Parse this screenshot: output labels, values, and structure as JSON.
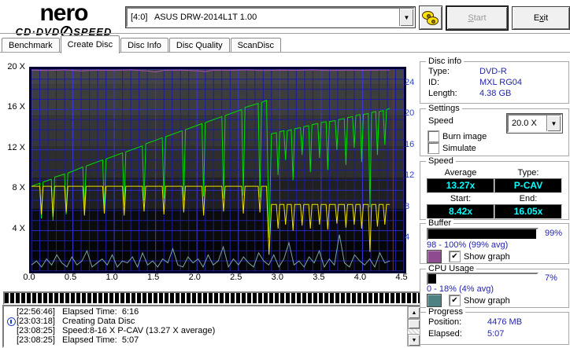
{
  "header": {
    "logo_name": "nero",
    "logo_sub_left": "CD·DVD",
    "logo_sub_right": "SPEED",
    "drive_selector": "[4:0]   ASUS DRW-2014L1T 1.00",
    "start_button": {
      "u": "S",
      "rest": "tart"
    },
    "exit_button": {
      "pre": "E",
      "u": "x",
      "rest": "it"
    }
  },
  "tabs": [
    {
      "label": "Benchmark",
      "active": false
    },
    {
      "label": "Create Disc",
      "active": true
    },
    {
      "label": "Disc Info",
      "active": false
    },
    {
      "label": "Disc Quality",
      "active": false
    },
    {
      "label": "ScanDisc",
      "active": false
    }
  ],
  "disc_info": {
    "title": "Disc info",
    "type_label": "Type:",
    "type_value": "DVD-R",
    "id_label": "ID:",
    "id_value": "MXL RG04",
    "length_label": "Length:",
    "length_value": "4.38 GB"
  },
  "settings": {
    "title": "Settings",
    "speed_label": "Speed",
    "speed_value": "20.0 X",
    "burn_image_label": "Burn image",
    "simulate_label": "Simulate",
    "burn_image_checked": false,
    "simulate_checked": false
  },
  "speed_panel": {
    "title": "Speed",
    "average_label": "Average",
    "average_value": "13.27x",
    "type_label": "Type:",
    "type_value": "P-CAV",
    "start_label": "Start:",
    "start_value": "8.42x",
    "end_label": "End:",
    "end_value": "16.05x"
  },
  "buffer_panel": {
    "title": "Buffer",
    "percent_label": "99%",
    "percent_value": 99,
    "range_text": "98 - 100% (99% avg)",
    "show_graph_label": "Show graph",
    "show_graph_checked": true,
    "swatch_color": "#8e4b8e"
  },
  "cpu_panel": {
    "title": "CPU Usage",
    "percent_label": "7%",
    "percent_value": 7,
    "range_text": "0 - 18% (4% avg)",
    "show_graph_label": "Show graph",
    "show_graph_checked": true,
    "swatch_color": "#4e8282"
  },
  "progress_panel": {
    "title": "Progress",
    "position_label": "Position:",
    "position_value": "4476 MB",
    "elapsed_label": "Elapsed:",
    "elapsed_value": "5:07"
  },
  "write_progress_percent": 100,
  "log": {
    "entries": [
      {
        "time": "[22:56:46]",
        "text": "Elapsed Time:  6:16",
        "icon": false
      },
      {
        "time": "[23:03:18]",
        "text": "Creating Data Disc",
        "icon": true
      },
      {
        "time": "[23:08:25]",
        "text": "Speed:8-16 X P-CAV (13.27 X average)",
        "icon": false
      },
      {
        "time": "[23:08:25]",
        "text": "Elapsed Time:  5:07",
        "icon": false
      }
    ]
  },
  "chart_data": {
    "type": "line",
    "x_max": 4.5,
    "x_ticks": [
      "0.0",
      "0.5",
      "1.0",
      "1.5",
      "2.0",
      "2.5",
      "3.0",
      "3.5",
      "4.0",
      "4.5"
    ],
    "left_axis": {
      "max": 20,
      "ticks": [
        20,
        16,
        12,
        8,
        4
      ],
      "suffix": " X"
    },
    "right_axis": {
      "max": 26,
      "ticks": [
        24,
        20,
        16,
        12,
        8,
        4
      ]
    },
    "position_line_x": 4.37,
    "position_line_color": "#cc1111",
    "series": [
      {
        "name": "write-speed",
        "color": "#00dd00",
        "axis": "left",
        "points": [
          [
            0,
            8.4
          ],
          [
            0.1,
            8.7
          ],
          [
            0.12,
            5.2
          ],
          [
            0.14,
            8.8
          ],
          [
            0.24,
            9.1
          ],
          [
            0.26,
            5.0
          ],
          [
            0.28,
            9.3
          ],
          [
            0.4,
            9.6
          ],
          [
            0.42,
            5.6
          ],
          [
            0.44,
            9.7
          ],
          [
            0.62,
            10.3
          ],
          [
            0.64,
            6.2
          ],
          [
            0.66,
            10.4
          ],
          [
            0.86,
            11.0
          ],
          [
            0.88,
            6.0
          ],
          [
            0.9,
            11.1
          ],
          [
            1.1,
            11.7
          ],
          [
            1.12,
            6.5
          ],
          [
            1.14,
            11.8
          ],
          [
            1.34,
            12.4
          ],
          [
            1.36,
            7.0
          ],
          [
            1.38,
            12.6
          ],
          [
            1.58,
            13.2
          ],
          [
            1.6,
            7.2
          ],
          [
            1.62,
            13.3
          ],
          [
            1.82,
            13.9
          ],
          [
            1.84,
            7.0
          ],
          [
            1.86,
            14.0
          ],
          [
            2.06,
            14.6
          ],
          [
            2.08,
            7.4
          ],
          [
            2.1,
            14.7
          ],
          [
            2.3,
            15.3
          ],
          [
            2.32,
            7.2
          ],
          [
            2.34,
            15.4
          ],
          [
            2.54,
            16.0
          ],
          [
            2.56,
            7.5
          ],
          [
            2.58,
            16.2
          ],
          [
            2.74,
            16.6
          ],
          [
            2.76,
            7.3
          ],
          [
            2.78,
            16.7
          ],
          [
            2.84,
            16.9
          ],
          [
            2.87,
            3.3
          ],
          [
            2.9,
            13.6
          ],
          [
            2.96,
            13.7
          ],
          [
            2.98,
            9.5
          ],
          [
            3.0,
            13.8
          ],
          [
            3.05,
            13.9
          ],
          [
            3.07,
            11.0
          ],
          [
            3.09,
            13.9
          ],
          [
            3.14,
            14.0
          ],
          [
            3.16,
            9.0
          ],
          [
            3.18,
            14.1
          ],
          [
            3.25,
            14.2
          ],
          [
            3.27,
            11.5
          ],
          [
            3.29,
            14.3
          ],
          [
            3.35,
            14.4
          ],
          [
            3.37,
            9.8
          ],
          [
            3.39,
            14.5
          ],
          [
            3.46,
            14.6
          ],
          [
            3.48,
            11.2
          ],
          [
            3.5,
            14.7
          ],
          [
            3.56,
            14.8
          ],
          [
            3.58,
            10.0
          ],
          [
            3.6,
            14.8
          ],
          [
            3.67,
            14.9
          ],
          [
            3.69,
            12.0
          ],
          [
            3.71,
            15.0
          ],
          [
            3.78,
            15.1
          ],
          [
            3.8,
            10.5
          ],
          [
            3.82,
            15.2
          ],
          [
            3.88,
            15.3
          ],
          [
            3.9,
            12.2
          ],
          [
            3.92,
            15.4
          ],
          [
            3.97,
            15.5
          ],
          [
            3.99,
            10.8
          ],
          [
            4.01,
            15.5
          ],
          [
            4.07,
            15.6
          ],
          [
            4.09,
            6.3
          ],
          [
            4.11,
            15.7
          ],
          [
            4.16,
            15.8
          ],
          [
            4.18,
            11.5
          ],
          [
            4.2,
            15.8
          ],
          [
            4.25,
            15.9
          ],
          [
            4.27,
            12.5
          ],
          [
            4.29,
            16.0
          ],
          [
            4.33,
            16.1
          ]
        ]
      },
      {
        "name": "read-speed",
        "color": "#ece000",
        "axis": "left",
        "points": [
          [
            0,
            8.4
          ],
          [
            0.1,
            8.4
          ],
          [
            0.12,
            5.6
          ],
          [
            0.14,
            8.4
          ],
          [
            0.24,
            8.4
          ],
          [
            0.26,
            5.4
          ],
          [
            0.28,
            8.4
          ],
          [
            0.4,
            8.4
          ],
          [
            0.42,
            5.8
          ],
          [
            0.44,
            8.4
          ],
          [
            0.62,
            8.4
          ],
          [
            0.64,
            5.5
          ],
          [
            0.66,
            8.4
          ],
          [
            0.86,
            8.4
          ],
          [
            0.88,
            5.7
          ],
          [
            0.9,
            8.4
          ],
          [
            1.1,
            8.4
          ],
          [
            1.12,
            5.5
          ],
          [
            1.14,
            8.4
          ],
          [
            1.34,
            8.4
          ],
          [
            1.36,
            5.9
          ],
          [
            1.38,
            8.4
          ],
          [
            1.58,
            8.4
          ],
          [
            1.6,
            5.6
          ],
          [
            1.62,
            8.4
          ],
          [
            1.82,
            8.4
          ],
          [
            1.84,
            5.8
          ],
          [
            1.86,
            8.4
          ],
          [
            2.06,
            8.4
          ],
          [
            2.08,
            5.5
          ],
          [
            2.1,
            8.4
          ],
          [
            2.3,
            8.4
          ],
          [
            2.32,
            5.9
          ],
          [
            2.34,
            8.4
          ],
          [
            2.54,
            8.4
          ],
          [
            2.56,
            5.7
          ],
          [
            2.58,
            8.4
          ],
          [
            2.74,
            8.4
          ],
          [
            2.76,
            5.8
          ],
          [
            2.78,
            8.4
          ],
          [
            2.84,
            8.4
          ],
          [
            2.87,
            1.6
          ],
          [
            2.9,
            6.6
          ],
          [
            2.96,
            6.6
          ],
          [
            2.98,
            4.2
          ],
          [
            3.0,
            6.6
          ],
          [
            3.05,
            6.6
          ],
          [
            3.07,
            4.6
          ],
          [
            3.09,
            6.6
          ],
          [
            3.14,
            6.6
          ],
          [
            3.16,
            4.0
          ],
          [
            3.18,
            6.6
          ],
          [
            3.25,
            6.6
          ],
          [
            3.27,
            4.5
          ],
          [
            3.29,
            6.6
          ],
          [
            3.35,
            6.6
          ],
          [
            3.37,
            4.2
          ],
          [
            3.39,
            6.6
          ],
          [
            3.46,
            6.6
          ],
          [
            3.48,
            4.6
          ],
          [
            3.5,
            6.6
          ],
          [
            3.56,
            6.6
          ],
          [
            3.58,
            4.1
          ],
          [
            3.6,
            6.6
          ],
          [
            3.67,
            6.6
          ],
          [
            3.69,
            4.7
          ],
          [
            3.71,
            6.6
          ],
          [
            3.78,
            6.6
          ],
          [
            3.8,
            4.3
          ],
          [
            3.82,
            6.6
          ],
          [
            3.88,
            6.6
          ],
          [
            3.9,
            4.6
          ],
          [
            3.92,
            6.6
          ],
          [
            3.97,
            6.6
          ],
          [
            3.99,
            4.2
          ],
          [
            4.01,
            6.6
          ],
          [
            4.07,
            6.6
          ],
          [
            4.09,
            1.9
          ],
          [
            4.11,
            6.6
          ],
          [
            4.16,
            6.6
          ],
          [
            4.18,
            4.4
          ],
          [
            4.2,
            6.6
          ],
          [
            4.25,
            6.6
          ],
          [
            4.27,
            4.6
          ],
          [
            4.29,
            6.6
          ],
          [
            4.33,
            6.6
          ]
        ]
      },
      {
        "name": "buffer-level",
        "color": "#a855a8",
        "axis": "percent",
        "points": [
          [
            0,
            99.5
          ],
          [
            0.2,
            99.3
          ],
          [
            0.4,
            99.6
          ],
          [
            0.6,
            99.2
          ],
          [
            0.8,
            99.5
          ],
          [
            1.0,
            99.4
          ],
          [
            1.2,
            99.6
          ],
          [
            1.4,
            99.1
          ],
          [
            1.5,
            98.6
          ],
          [
            1.6,
            99.4
          ],
          [
            1.8,
            99.5
          ],
          [
            2.0,
            99.2
          ],
          [
            2.1,
            98.8
          ],
          [
            2.2,
            99.5
          ],
          [
            2.4,
            99.4
          ],
          [
            2.6,
            99.6
          ],
          [
            2.8,
            99.3
          ],
          [
            3.0,
            99.5
          ],
          [
            3.2,
            99.4
          ],
          [
            3.4,
            99.6
          ],
          [
            3.6,
            99.3
          ],
          [
            3.8,
            99.5
          ],
          [
            4.0,
            99.4
          ],
          [
            4.2,
            99.5
          ],
          [
            4.33,
            99.5
          ]
        ]
      },
      {
        "name": "cpu-usage",
        "color": "#7aa3a3",
        "axis": "percent",
        "x0": 0,
        "dx": 0.061,
        "values": [
          3,
          5,
          2,
          6,
          3,
          8,
          4,
          2,
          7,
          3,
          5,
          10,
          2,
          4,
          6,
          3,
          8,
          2,
          5,
          4,
          7,
          2,
          9,
          3,
          5,
          2,
          6,
          4,
          11,
          3,
          2,
          7,
          4,
          6,
          2,
          8,
          3,
          5,
          12,
          2,
          6,
          3,
          7,
          4,
          2,
          9,
          5,
          3,
          8,
          2,
          6,
          14,
          3,
          5,
          2,
          7,
          4,
          10,
          2,
          6,
          3,
          18,
          4,
          2,
          8,
          5,
          3,
          6,
          2,
          9,
          4,
          5
        ]
      }
    ]
  }
}
